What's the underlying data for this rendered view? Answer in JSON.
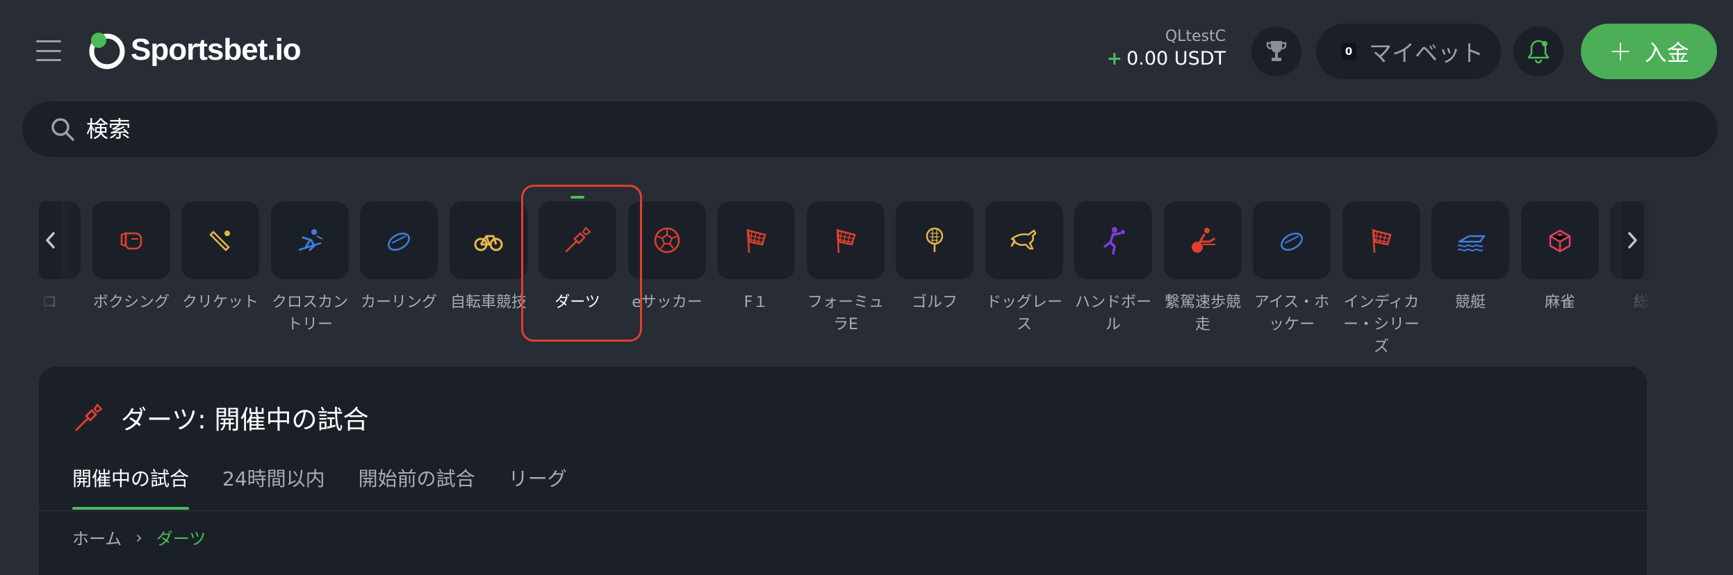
{
  "header": {
    "logo_text": "Sportsbet.io",
    "username": "QLtestC",
    "balance_sign": "+",
    "balance": "0.00 USDT",
    "mybets_count": "0",
    "mybets_label": "マイベット",
    "deposit_plus": "+",
    "deposit_label": "入金"
  },
  "search": {
    "placeholder": "検索"
  },
  "sports": [
    {
      "label": "スロ",
      "icon": "partial-icon",
      "color": "#8a8f97"
    },
    {
      "label": "ボクシング",
      "icon": "boxing-glove-icon",
      "color": "#e0402f"
    },
    {
      "label": "クリケット",
      "icon": "cricket-bat-icon",
      "color": "#e8b84a"
    },
    {
      "label": "クロスカントリー",
      "icon": "skier-icon",
      "color": "#3f7fe0"
    },
    {
      "label": "カーリング",
      "icon": "curling-stone-icon",
      "color": "#3f7fe0"
    },
    {
      "label": "自転車競技",
      "icon": "bicycle-icon",
      "color": "#e8b84a"
    },
    {
      "label": "ダーツ",
      "icon": "dart-icon",
      "color": "#e0402f",
      "active": true
    },
    {
      "label": "eサッカー",
      "icon": "soccer-ball-icon",
      "color": "#e0402f"
    },
    {
      "label": "F１",
      "icon": "checkered-flag-icon",
      "color": "#e0402f"
    },
    {
      "label": "フォーミュラE",
      "icon": "checkered-flag-icon",
      "color": "#e0402f"
    },
    {
      "label": "ゴルフ",
      "icon": "golf-ball-icon",
      "color": "#e8b84a"
    },
    {
      "label": "ドッグレース",
      "icon": "greyhound-icon",
      "color": "#e8b84a"
    },
    {
      "label": "ハンドボール",
      "icon": "handball-player-icon",
      "color": "#7a3fe0"
    },
    {
      "label": "繋駕速歩競走",
      "icon": "harness-racing-icon",
      "color": "#e0402f"
    },
    {
      "label": "アイス・ホッケー",
      "icon": "hockey-puck-icon",
      "color": "#3f7fe0"
    },
    {
      "label": "インディカー・シリーズ",
      "icon": "checkered-flag-icon",
      "color": "#e0402f"
    },
    {
      "label": "競艇",
      "icon": "speedboat-icon",
      "color": "#3f7fe0"
    },
    {
      "label": "麻雀",
      "icon": "mahjong-tile-icon",
      "color": "#e0405a"
    },
    {
      "label": "総合",
      "icon": "partial-icon",
      "color": "#8a8f97"
    }
  ],
  "panel": {
    "title": "ダーツ: 開催中の試合",
    "tabs": [
      "開催中の試合",
      "24時間以内",
      "開始前の試合",
      "リーグ"
    ],
    "breadcrumb_home": "ホーム",
    "breadcrumb_sep": "›",
    "breadcrumb_current": "ダーツ"
  },
  "colors": {
    "accent_green": "#4cae56",
    "highlight_red": "#e0402f"
  }
}
